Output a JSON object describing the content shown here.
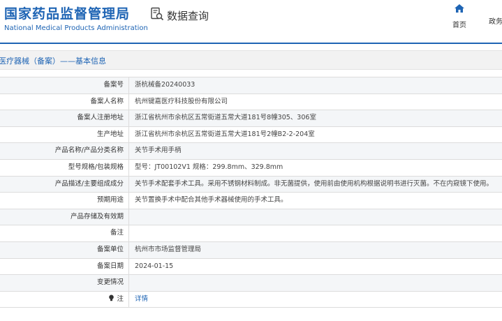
{
  "header": {
    "brand_cn": "国家药品监督管理局",
    "brand_en": "National Medical Products Administration",
    "query_icon": "search-document-icon",
    "query_label": "数据查询",
    "nav": [
      {
        "label": "首页",
        "icon": "home-icon"
      },
      {
        "label": "政务"
      }
    ],
    "accent_color": "#1e64b4"
  },
  "section": {
    "title": "医疗器械（备案）——基本信息"
  },
  "table": {
    "rows": [
      {
        "label": "备案号",
        "value": "浙杭械备20240033"
      },
      {
        "label": "备案人名称",
        "value": "杭州键嘉医疗科技股份有限公司"
      },
      {
        "label": "备案人注册地址",
        "value": "浙江省杭州市余杭区五常街道五常大道181号8幢305、306室"
      },
      {
        "label": "生产地址",
        "value": "浙江省杭州市余杭区五常街道五常大道181号2幢B2-2-204室"
      },
      {
        "label": "产品名称/产品分类名称",
        "value": "关节手术用手柄"
      },
      {
        "label": "型号规格/包装规格",
        "value": "型号：JT00102V1 规格：299.8mm、329.8mm"
      },
      {
        "label": "产品描述/主要组成成分",
        "value": "关节手术配套手术工具。采用不锈钢材料制成。非无菌提供，使用前由使用机构根据说明书进行灭菌。不在内窥镜下使用。"
      },
      {
        "label": "预期用途",
        "value": "关节置换手术中配合其他手术器械使用的手术工具。"
      },
      {
        "label": "产品存储及有效期",
        "value": ""
      },
      {
        "label": "备注",
        "value": ""
      },
      {
        "label": "备案单位",
        "value": "杭州市市场监督管理局"
      },
      {
        "label": "备案日期",
        "value": "2024-01-15"
      },
      {
        "label": "变更情况",
        "value": ""
      },
      {
        "label": "注",
        "label_icon": "bulb-icon",
        "value": "详情"
      }
    ]
  }
}
